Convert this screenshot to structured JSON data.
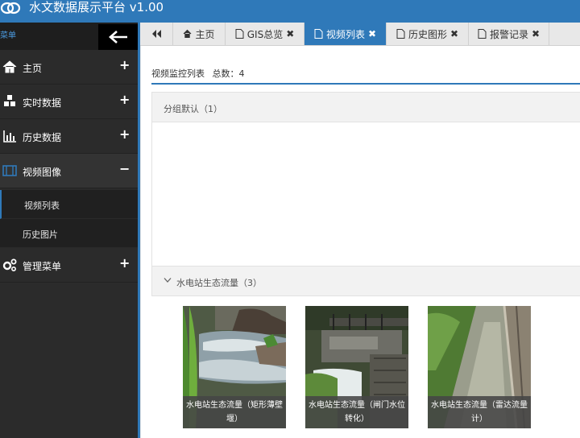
{
  "header": {
    "title": "水文数据展示平台 v1.00"
  },
  "sidebar": {
    "menu_label": "菜单",
    "items": [
      {
        "label": "主页",
        "icon": "home-icon",
        "sign": "+"
      },
      {
        "label": "实时数据",
        "icon": "cubes-icon",
        "sign": "+"
      },
      {
        "label": "历史数据",
        "icon": "bar-chart-icon",
        "sign": "+"
      },
      {
        "label": "视频图像",
        "icon": "film-icon",
        "sign": "−"
      },
      {
        "label": "管理菜单",
        "icon": "gears-icon",
        "sign": "+"
      }
    ],
    "subitems": [
      {
        "label": "视频列表"
      },
      {
        "label": "历史图片"
      }
    ]
  },
  "tabs": [
    {
      "label": "主页",
      "icon": "home-icon"
    },
    {
      "label": "GIS总览",
      "icon": "file-icon",
      "close": "✖"
    },
    {
      "label": "视频列表",
      "icon": "file-icon",
      "close": "✖"
    },
    {
      "label": "历史图形",
      "icon": "file-icon",
      "close": "✖"
    },
    {
      "label": "报警记录",
      "icon": "file-icon",
      "close": "✖"
    }
  ],
  "content": {
    "list_title": "视频监控列表",
    "total_label": "总数：4",
    "groups": [
      {
        "label": "分组默认（1）"
      },
      {
        "label": "水电站生态流量（3）"
      }
    ],
    "videos": [
      {
        "caption": "水电站生态流量（矩形薄壁堰）"
      },
      {
        "caption": "水电站生态流量（闸门水位转化）"
      },
      {
        "caption": "水电站生态流量（雷达流量计）"
      }
    ]
  },
  "colors": {
    "accent": "#2f79b9",
    "sidebar_bg": "#2b2b2b"
  }
}
